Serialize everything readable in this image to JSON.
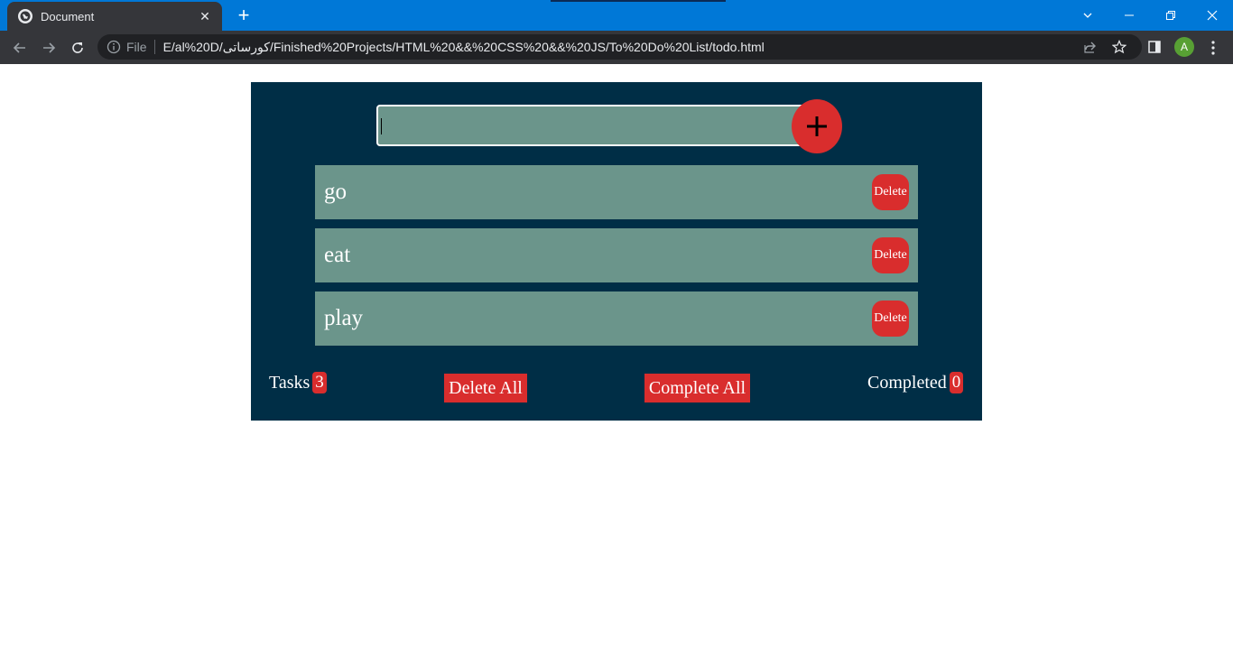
{
  "browser": {
    "tab_title": "Document",
    "tab_close": "✕",
    "new_tab": "+",
    "file_label": "File",
    "url": "E/al%20D/کورساتی/Finished%20Projects/HTML%20&&%20CSS%20&&%20JS/To%20Do%20List/todo.html",
    "avatar_letter": "A"
  },
  "todo": {
    "input_value": "",
    "tasks": [
      {
        "text": "go",
        "delete_label": "Delete"
      },
      {
        "text": "eat",
        "delete_label": "Delete"
      },
      {
        "text": "play",
        "delete_label": "Delete"
      }
    ],
    "tasks_label": "Tasks",
    "tasks_count": "3",
    "delete_all_label": "Delete All",
    "complete_all_label": "Complete All",
    "completed_label": "Completed",
    "completed_count": "0"
  },
  "colors": {
    "app_background": "#002e46",
    "item_background": "#6b958b",
    "accent_red": "#d92d2d",
    "titlebar_blue": "#0078d7"
  },
  "icons": {
    "add": "plus-icon",
    "favicon": "globe-icon"
  }
}
